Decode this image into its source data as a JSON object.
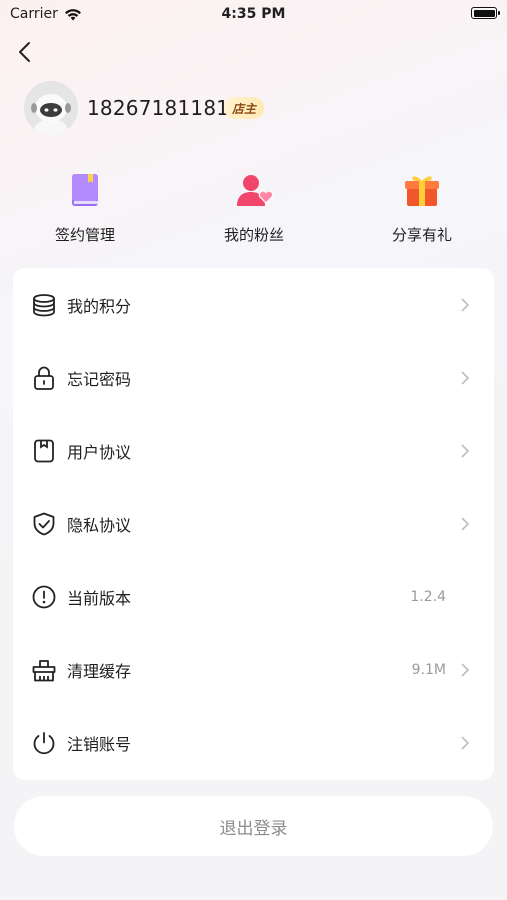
{
  "status_bar": {
    "carrier": "Carrier",
    "time": "4:35 PM"
  },
  "profile": {
    "phone": "18267181181",
    "badge": "店主"
  },
  "quick_actions": [
    {
      "label": "签约管理",
      "icon": "book-icon"
    },
    {
      "label": "我的粉丝",
      "icon": "fans-icon"
    },
    {
      "label": "分享有礼",
      "icon": "gift-icon"
    }
  ],
  "menu": {
    "items": [
      {
        "label": "我的积分",
        "icon": "coins-icon",
        "value": ""
      },
      {
        "label": "忘记密码",
        "icon": "lock-icon",
        "value": ""
      },
      {
        "label": "用户协议",
        "icon": "document-icon",
        "value": ""
      },
      {
        "label": "隐私协议",
        "icon": "shield-check-icon",
        "value": ""
      },
      {
        "label": "当前版本",
        "icon": "info-icon",
        "value": "1.2.4"
      },
      {
        "label": "清理缓存",
        "icon": "basket-icon",
        "value": "9.1M"
      },
      {
        "label": "注销账号",
        "icon": "power-icon",
        "value": ""
      }
    ]
  },
  "logout": {
    "label": "退出登录"
  }
}
